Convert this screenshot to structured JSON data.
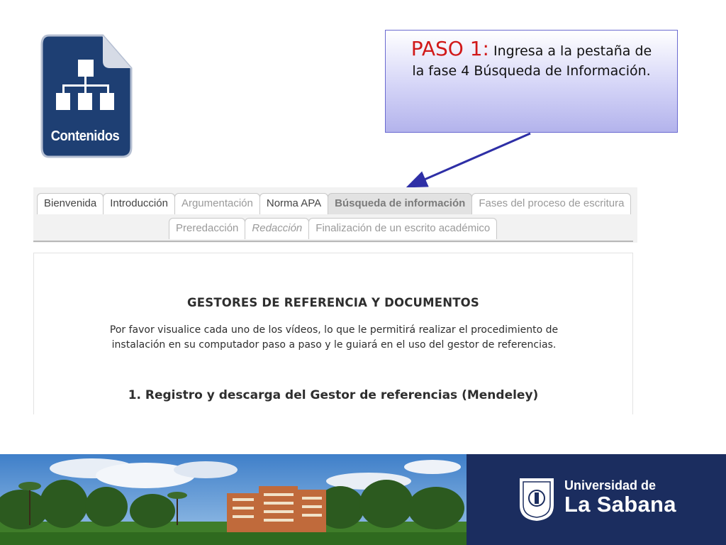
{
  "icon": {
    "label": "Contenidos",
    "color": "#1e3f73"
  },
  "callout": {
    "step": "PASO 1:",
    "text_line1": " Ingresa a la pestaña de",
    "text_line2": "la fase 4 Búsqueda de Información."
  },
  "tabs": {
    "row1": [
      {
        "label": "Bienvenida"
      },
      {
        "label": "Introducción"
      },
      {
        "label": "Argumentación"
      },
      {
        "label": "Norma APA"
      },
      {
        "label": "Búsqueda de información"
      },
      {
        "label": "Fases del proceso de escritura"
      }
    ],
    "row2": [
      {
        "label": "Preredacción"
      },
      {
        "label": "Redacción"
      },
      {
        "label": "Finalización de un escrito académico"
      }
    ],
    "active": "Búsqueda de información"
  },
  "content": {
    "heading": "GESTORES DE REFERENCIA Y DOCUMENTOS",
    "description": "Por favor visualice cada uno de los vídeos, lo que le permitirá realizar el procedimiento de instalación en su computador paso a paso y le guiará en el uso del gestor de referencias.",
    "section1": "1. Registro y descarga del Gestor de referencias (Mendeley)"
  },
  "footer": {
    "brand_line1": "Universidad de",
    "brand_line2": "La Sabana",
    "brand_color": "#1b2d5f"
  }
}
